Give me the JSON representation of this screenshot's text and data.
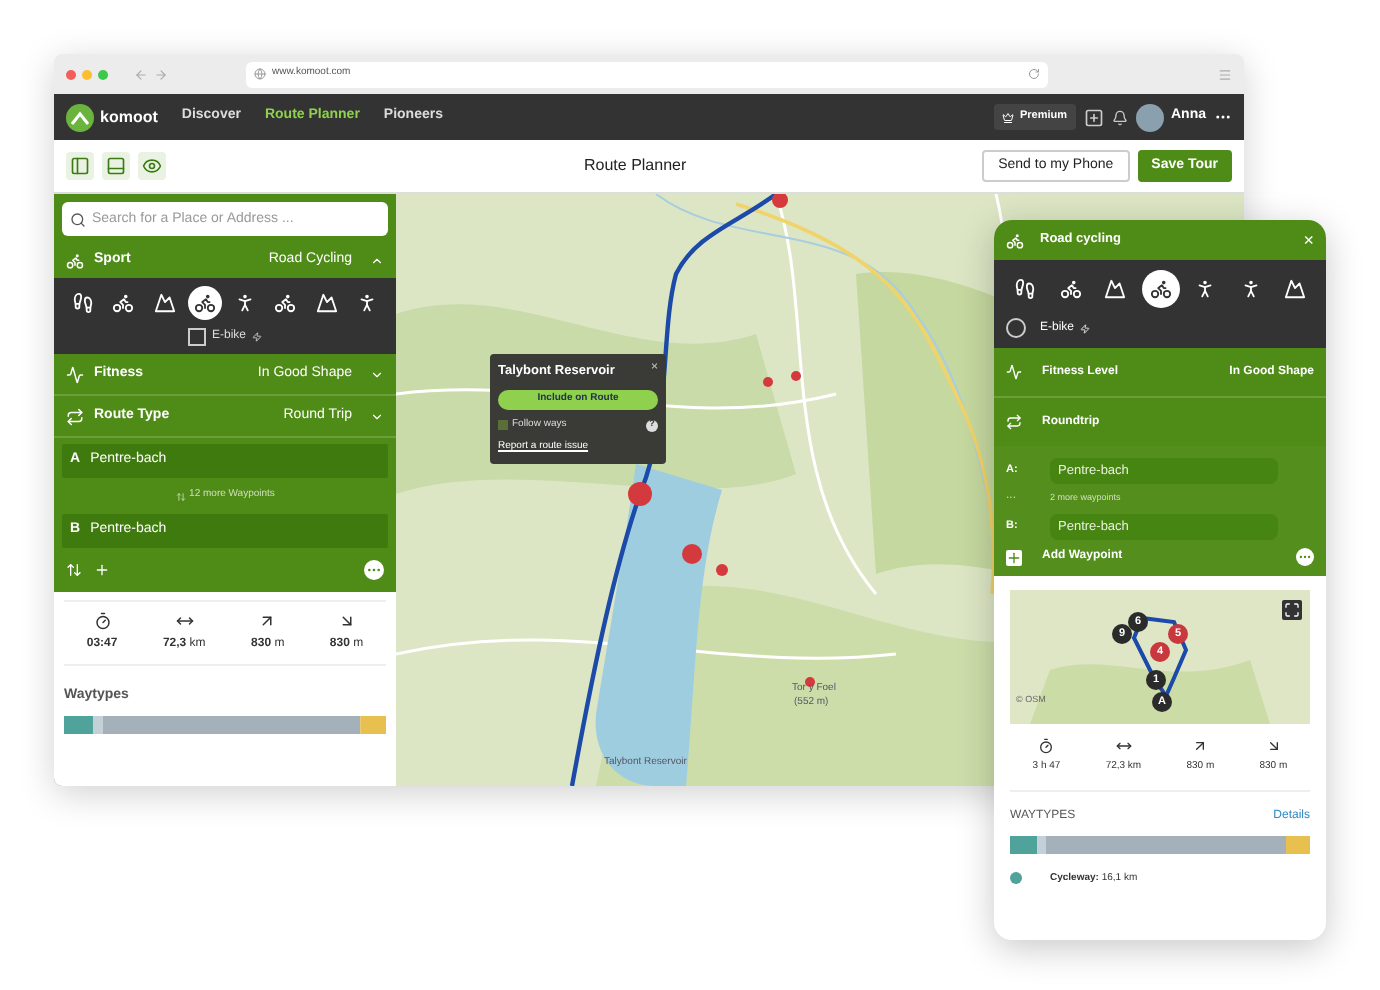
{
  "browser": {
    "url": "www.komoot.com"
  },
  "nav": {
    "logo": "komoot",
    "links": [
      {
        "label": "Discover",
        "selected": false
      },
      {
        "label": "Route Planner",
        "selected": true
      },
      {
        "label": "Pioneers",
        "selected": false
      }
    ],
    "premium": "Premium",
    "user": "Anna"
  },
  "toolbar": {
    "title": "Route Planner",
    "send": "Send to my Phone",
    "save": "Save Tour"
  },
  "sidebar": {
    "search": {
      "placeholder": "Search for a Place or Address ..."
    },
    "sport": {
      "label": "Sport",
      "value": "Road Cycling"
    },
    "sports": [
      {
        "kind": "hike",
        "selected": false
      },
      {
        "kind": "bike",
        "selected": false
      },
      {
        "kind": "mtb",
        "selected": false
      },
      {
        "kind": "road",
        "selected": true
      },
      {
        "kind": "run",
        "selected": false
      },
      {
        "kind": "bike",
        "selected": false
      },
      {
        "kind": "mtb",
        "selected": false
      },
      {
        "kind": "climb",
        "selected": false
      }
    ],
    "ebike": {
      "label": "E-bike",
      "checked": false
    },
    "fitness": {
      "label": "Fitness",
      "value": "In Good Shape"
    },
    "route_type": {
      "label": "Route Type",
      "value": "Round Trip"
    },
    "waypoints": [
      {
        "letter": "A",
        "name": "Pentre-bach"
      },
      {
        "letter": "B",
        "name": "Pentre-bach"
      }
    ],
    "more_waypoints": "12 more Waypoints",
    "stats": [
      {
        "kind": "duration",
        "value": "03:47"
      },
      {
        "kind": "distance",
        "value": "72,3",
        "unit": "km"
      },
      {
        "kind": "up",
        "value": "830",
        "unit": "m"
      },
      {
        "kind": "down",
        "value": "830",
        "unit": "m"
      }
    ],
    "waytypes": {
      "label": "Waytypes",
      "segments": [
        {
          "color": "#4fa39a"
        },
        {
          "color": "#c4d0d8"
        },
        {
          "color": "#a5b1ba"
        },
        {
          "color": "#e7c050"
        }
      ]
    }
  },
  "map": {
    "popup": {
      "title": "Talybont Reservoir",
      "button": "Include on Route",
      "follow": {
        "label": "Follow ways",
        "checked": false
      },
      "help": "?",
      "link": "Report a route issue",
      "close": "×"
    },
    "labels": [
      {
        "kind": "peak",
        "text": "Tor y Foel"
      },
      {
        "kind": "height",
        "text": "(552 m)"
      },
      {
        "kind": "water",
        "text": "Talybont Reservoir"
      }
    ]
  },
  "phone": {
    "title": "Road cycling",
    "close": "×",
    "sports": [
      {
        "kind": "hike",
        "selected": false
      },
      {
        "kind": "bike",
        "selected": false
      },
      {
        "kind": "mtb",
        "selected": false
      },
      {
        "kind": "road",
        "selected": true
      },
      {
        "kind": "climb",
        "selected": false
      },
      {
        "kind": "run",
        "selected": false
      },
      {
        "kind": "mtb",
        "selected": false
      }
    ],
    "ebike": {
      "label": "E-bike",
      "checked": false
    },
    "fitness": {
      "label": "Fitness Level",
      "value": "In Good Shape"
    },
    "route_type": "Roundtrip",
    "waypoints": [
      {
        "letter": "A:",
        "name": "Pentre-bach"
      },
      {
        "letter": "B:",
        "name": "Pentre-bach"
      }
    ],
    "more_dots": "···",
    "more_waypoints": "2 more waypoints",
    "add": "Add Waypoint",
    "markers": [
      {
        "text": "9",
        "color": "#2b2b2b"
      },
      {
        "text": "6",
        "color": "#2b2b2b"
      },
      {
        "text": "5",
        "color": "#c9383d"
      },
      {
        "text": "4",
        "color": "#c9383d"
      },
      {
        "text": "1",
        "color": "#2b2b2b"
      },
      {
        "text": "A",
        "color": "#2b2b2b"
      }
    ],
    "osm": "© OSM",
    "stats": [
      {
        "kind": "duration",
        "text": "3 h 47"
      },
      {
        "kind": "distance",
        "text": "72,3 km"
      },
      {
        "kind": "up",
        "text": "830 m"
      },
      {
        "kind": "down",
        "text": "830 m"
      }
    ],
    "waytypes": {
      "label": "WAYTYPES",
      "details": "Details",
      "segments": [
        {
          "color": "#4fa39a"
        },
        {
          "color": "#c4d0d8"
        },
        {
          "color": "#a5b1ba"
        },
        {
          "color": "#e7c050"
        }
      ],
      "legend": {
        "color": "#4fa39a",
        "label": "Cycleway:",
        "value": "16,1 km"
      }
    }
  }
}
